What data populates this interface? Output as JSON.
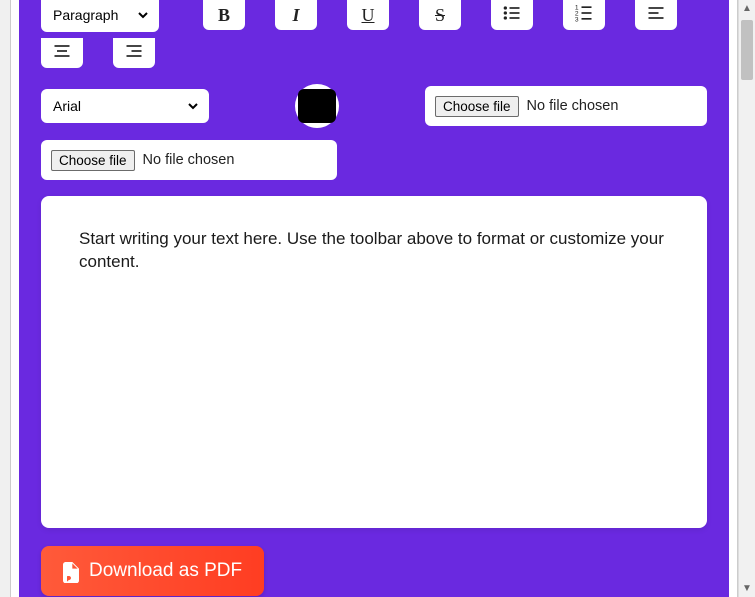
{
  "toolbar": {
    "paragraph_select": "Paragraph",
    "font_select": "Arial",
    "bold": "B",
    "italic": "I",
    "underline": "U",
    "strike": "S"
  },
  "file1": {
    "button": "Choose file",
    "status": "No file chosen"
  },
  "file2": {
    "button": "Choose file",
    "status": "No file chosen"
  },
  "editor": {
    "placeholder": "Start writing your text here. Use the toolbar above to format or customize your content."
  },
  "download": {
    "label": "Download as PDF"
  }
}
